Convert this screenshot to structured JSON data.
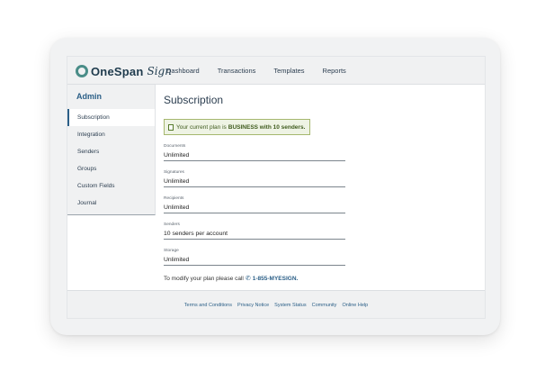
{
  "brand": {
    "name": "OneSpan",
    "product": "Sign"
  },
  "nav": [
    "Dashboard",
    "Transactions",
    "Templates",
    "Reports"
  ],
  "sidebar": {
    "title": "Admin",
    "items": [
      {
        "label": "Subscription",
        "active": true
      },
      {
        "label": "Integration"
      },
      {
        "label": "Senders"
      },
      {
        "label": "Groups"
      },
      {
        "label": "Custom Fields"
      },
      {
        "label": "Journal"
      }
    ]
  },
  "page": {
    "title": "Subscription",
    "plan_notice_prefix": "Your current plan is",
    "plan_notice_strong": "BUSINESS with 10 senders.",
    "fields": [
      {
        "label": "Documents",
        "value": "Unlimited"
      },
      {
        "label": "Signatures",
        "value": "Unlimited"
      },
      {
        "label": "Recipients",
        "value": "Unlimited"
      },
      {
        "label": "Senders",
        "value": "10 senders per account"
      },
      {
        "label": "Storage",
        "value": "Unlimited"
      }
    ],
    "modify_note": "To modify your plan please call",
    "phone": "1-855-MYESIGN."
  },
  "footer": [
    "Terms and Conditions",
    "Privacy Notice",
    "System Status",
    "Community",
    "Online Help"
  ],
  "colors": {
    "accent": "#2b5f87",
    "plan_bg": "#eef3e4",
    "plan_border": "#a6b86f"
  }
}
